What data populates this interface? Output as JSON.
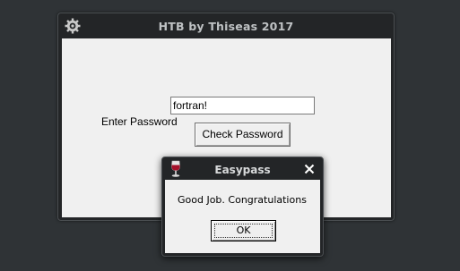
{
  "main_window": {
    "title": "HTB by Thiseas 2017",
    "icon": "gear-icon",
    "password_label": "Enter Password",
    "password_value": "fortran!",
    "check_button_label": "Check Password"
  },
  "dialog": {
    "title": "Easypass",
    "icon": "wine-glass-icon",
    "close_icon": "close-icon",
    "message": "Good Job. Congratulations",
    "ok_label": "OK"
  },
  "colors": {
    "desktop": "#2f3336",
    "titlebar": "#232527",
    "client": "#f0f0f0"
  }
}
